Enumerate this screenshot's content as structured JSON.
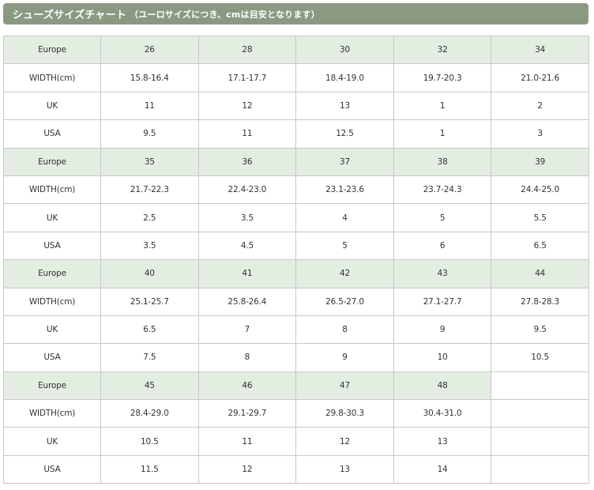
{
  "title": {
    "main": "シューズサイズチャート",
    "note": "（ユーロサイズにつき、cmは目安となります）"
  },
  "colors": {
    "title_bar": "#8a9a82",
    "europe_row": "#e3ede2",
    "border": "#c8c8c8"
  },
  "blocks": [
    {
      "europe": [
        "Europe",
        "26",
        "28",
        "30",
        "32",
        "34"
      ],
      "width": [
        "WIDTH(cm)",
        "15.8-16.4",
        "17.1-17.7",
        "18.4-19.0",
        "19.7-20.3",
        "21.0-21.6"
      ],
      "uk": [
        "UK",
        "11",
        "12",
        "13",
        "1",
        "2"
      ],
      "usa": [
        "USA",
        "9.5",
        "11",
        "12.5",
        "1",
        "3"
      ]
    },
    {
      "europe": [
        "Europe",
        "35",
        "36",
        "37",
        "38",
        "39"
      ],
      "width": [
        "WIDTH(cm)",
        "21.7-22.3",
        "22.4-23.0",
        "23.1-23.6",
        "23.7-24.3",
        "24.4-25.0"
      ],
      "uk": [
        "UK",
        "2.5",
        "3.5",
        "4",
        "5",
        "5.5"
      ],
      "usa": [
        "USA",
        "3.5",
        "4.5",
        "5",
        "6",
        "6.5"
      ]
    },
    {
      "europe": [
        "Europe",
        "40",
        "41",
        "42",
        "43",
        "44"
      ],
      "width": [
        "WIDTH(cm)",
        "25.1-25.7",
        "25.8-26.4",
        "26.5-27.0",
        "27.1-27.7",
        "27.8-28.3"
      ],
      "uk": [
        "UK",
        "6.5",
        "7",
        "8",
        "9",
        "9.5"
      ],
      "usa": [
        "USA",
        "7.5",
        "8",
        "9",
        "10",
        "10.5"
      ]
    },
    {
      "europe": [
        "Europe",
        "45",
        "46",
        "47",
        "48",
        ""
      ],
      "width": [
        "WIDTH(cm)",
        "28.4-29.0",
        "29.1-29.7",
        "29.8-30.3",
        "30.4-31.0",
        ""
      ],
      "uk": [
        "UK",
        "10.5",
        "11",
        "12",
        "13",
        ""
      ],
      "usa": [
        "USA",
        "11.5",
        "12",
        "13",
        "14",
        ""
      ]
    }
  ]
}
